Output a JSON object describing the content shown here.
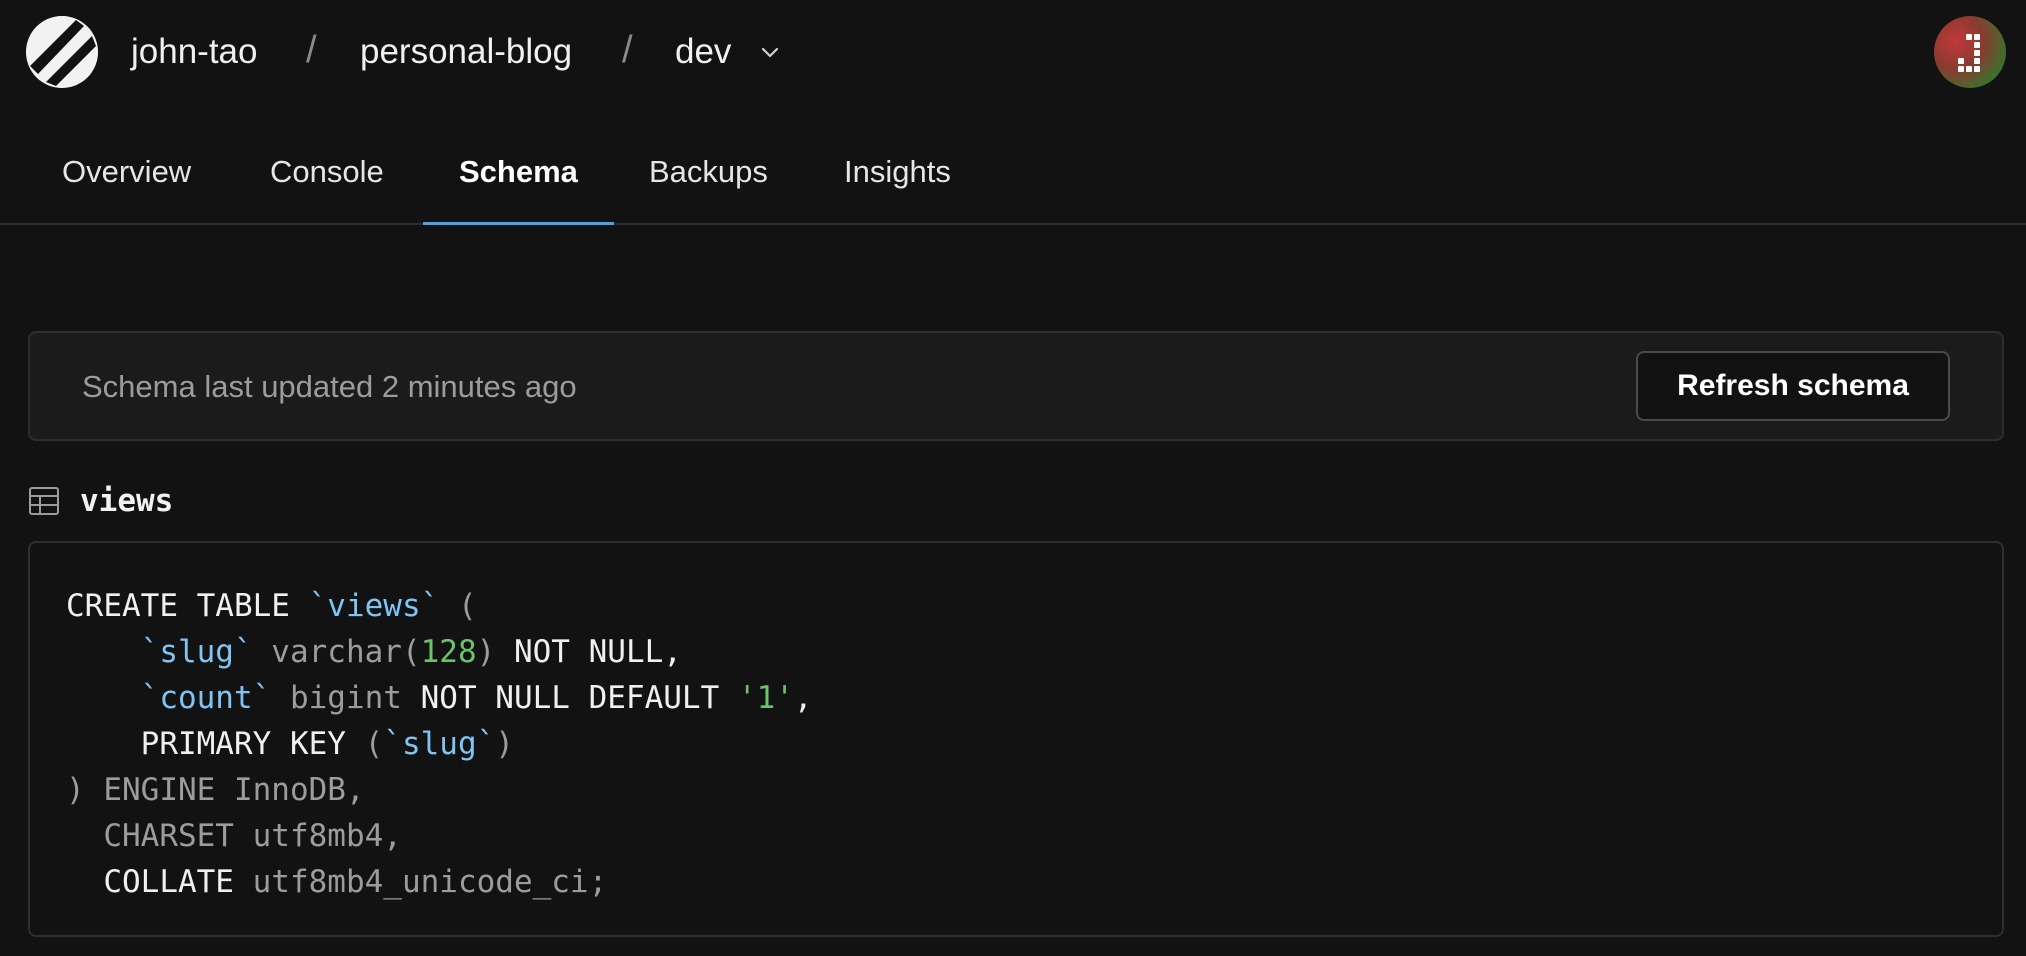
{
  "header": {
    "org": "john-tao",
    "separator": "/",
    "database": "personal-blog",
    "branch": "dev",
    "logo_icon": "planetscale-logo-icon",
    "avatar_icon": "user-avatar-icon"
  },
  "tabs": [
    {
      "label": "Overview",
      "active": false
    },
    {
      "label": "Console",
      "active": false
    },
    {
      "label": "Schema",
      "active": true
    },
    {
      "label": "Backups",
      "active": false
    },
    {
      "label": "Insights",
      "active": false
    }
  ],
  "status": {
    "text": "Schema last updated 2 minutes ago",
    "refresh_label": "Refresh schema"
  },
  "table": {
    "name": "views",
    "icon": "table-icon"
  },
  "code": {
    "line1": {
      "a": "CREATE TABLE ",
      "b": "`views`",
      "c": " ("
    },
    "line2": {
      "indent": "    ",
      "a": "`slug`",
      "b": " varchar(",
      "c": "128",
      "d": ")",
      "e": " NOT NULL,"
    },
    "line3": {
      "indent": "    ",
      "a": "`count`",
      "b": " bigint ",
      "c": "NOT NULL DEFAULT ",
      "d": "'1'",
      "e": ","
    },
    "line4": {
      "indent": "    ",
      "a": "PRIMARY KEY ",
      "b": "(",
      "c": "`slug`",
      "d": ")"
    },
    "line5": {
      "a": ") ENGINE InnoDB,"
    },
    "line6": {
      "indent": "  ",
      "a": "CHARSET utf8mb4,"
    },
    "line7": {
      "indent": "  ",
      "a": "COLLATE",
      "b": " utf8mb4_unicode_ci;"
    }
  },
  "colors": {
    "accent": "#4aa3e8",
    "identifier": "#7fc4f2",
    "literal": "#6cc36a",
    "muted": "#9c9c9c"
  }
}
